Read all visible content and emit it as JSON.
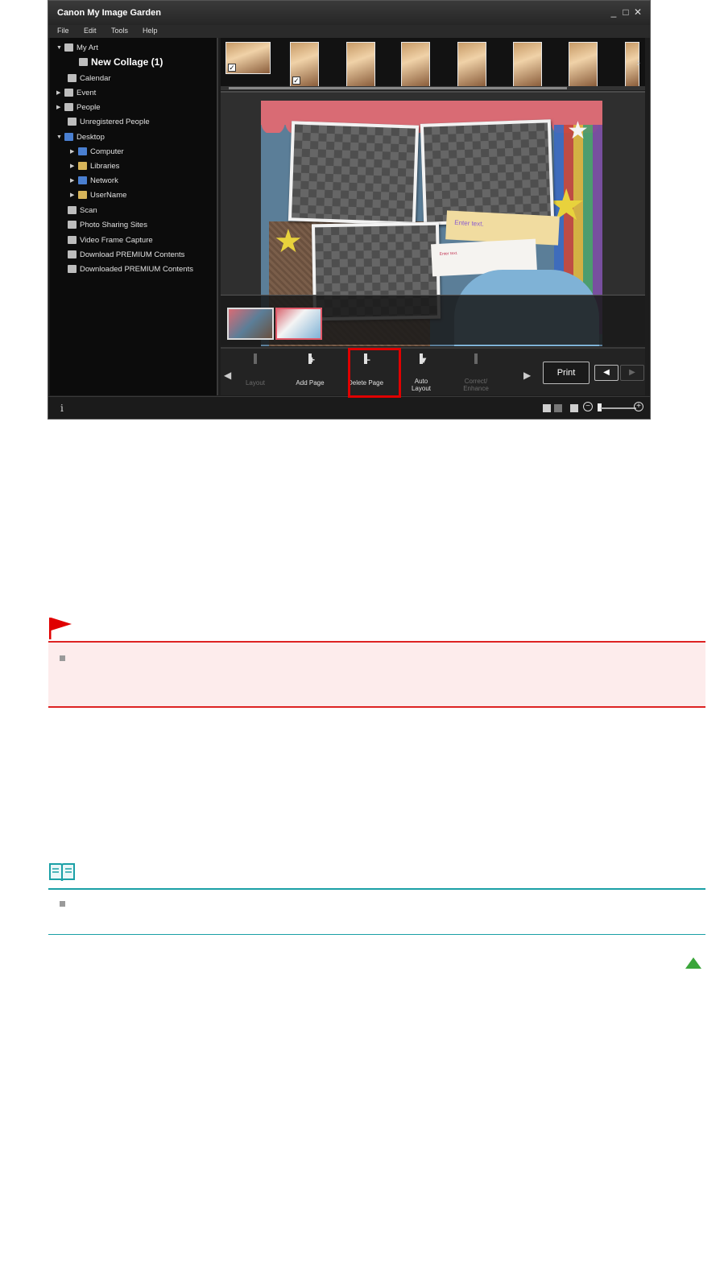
{
  "app": {
    "title": "Canon My Image Garden",
    "window_controls": [
      "_",
      "□",
      "✕"
    ],
    "menu": [
      "File",
      "Edit",
      "Tools",
      "Help"
    ]
  },
  "sidebar": {
    "items": [
      {
        "label": "My Art",
        "icon": "my-art-icon"
      },
      {
        "label": "New Collage (1)",
        "icon": "collage-icon"
      },
      {
        "label": "Calendar",
        "icon": "calendar-icon"
      },
      {
        "label": "Event",
        "icon": "event-icon"
      },
      {
        "label": "People",
        "icon": "people-icon"
      },
      {
        "label": "Unregistered People",
        "icon": "unregistered-people-icon"
      },
      {
        "label": "Desktop",
        "icon": "desktop-icon"
      },
      {
        "label": "Computer",
        "icon": "computer-icon"
      },
      {
        "label": "Libraries",
        "icon": "libraries-icon"
      },
      {
        "label": "Network",
        "icon": "network-icon"
      },
      {
        "label": "UserName",
        "icon": "user-folder-icon"
      },
      {
        "label": "Scan",
        "icon": "scan-icon"
      },
      {
        "label": "Photo Sharing Sites",
        "icon": "photo-sharing-icon"
      },
      {
        "label": "Video Frame Capture",
        "icon": "video-frame-icon"
      },
      {
        "label": "Download PREMIUM Contents",
        "icon": "download-premium-icon"
      },
      {
        "label": "Downloaded PREMIUM Contents",
        "icon": "downloaded-premium-icon"
      }
    ]
  },
  "canvas": {
    "text_box_placeholder": "Enter text.",
    "small_text_placeholder": "Enter text."
  },
  "toolbar": {
    "layout": "Layout",
    "add_page": "Add Page",
    "delete_page": "Delete Page",
    "auto_layout_1": "Auto",
    "auto_layout_2": "Layout",
    "correct_1": "Correct/",
    "correct_2": "Enhance",
    "print": "Print"
  },
  "status": {
    "info": "i"
  },
  "colors": {
    "important_accent": "#dd2222",
    "note_accent": "#1aa0a6",
    "highlight": "#e00000"
  }
}
